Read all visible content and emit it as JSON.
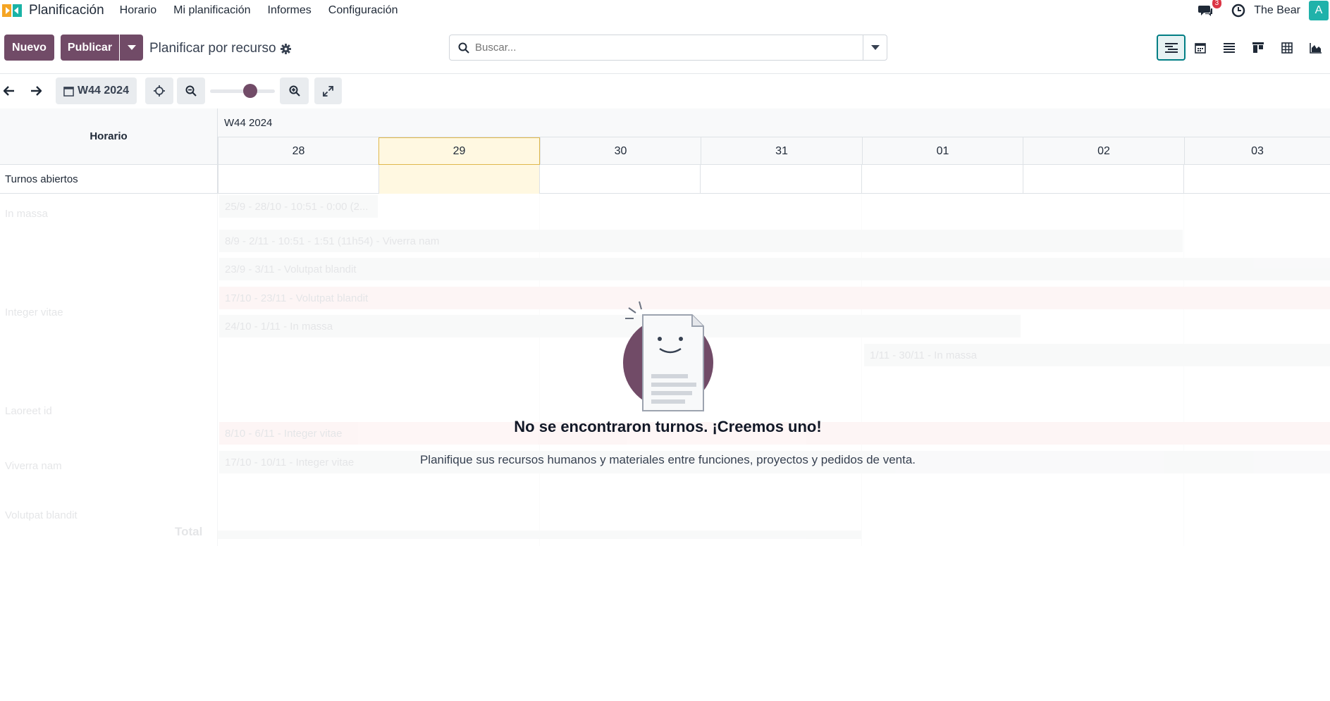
{
  "app": {
    "name": "Planificación"
  },
  "nav": [
    "Horario",
    "Mi planificación",
    "Informes",
    "Configuración"
  ],
  "user": {
    "name": "The Bear",
    "avatar_letter": "A",
    "messages_count": "3"
  },
  "toolbar": {
    "new_label": "Nuevo",
    "publish_label": "Publicar",
    "breadcrumb": "Planificar por recurso"
  },
  "search": {
    "placeholder": "Buscar..."
  },
  "views": [
    "gantt",
    "calendar",
    "list",
    "kanban",
    "pivot",
    "graph"
  ],
  "gantt": {
    "date_button": "W44 2024",
    "zoom_level": 0.65,
    "row_header": "Horario",
    "week_label": "W44 2024",
    "days": [
      "28",
      "29",
      "30",
      "31",
      "01",
      "02",
      "03"
    ],
    "today_index": 1,
    "open_shifts_label": "Turnos abiertos"
  },
  "sample": {
    "resources": [
      "In massa",
      "Integer vitae",
      "Laoreet id",
      "Viverra nam",
      "Volutpat blandit"
    ],
    "shifts": [
      "25/9 - 28/10 - 10:51 - 0:00 (2...",
      "8/9 - 2/11 - 10:51 - 1:51 (11h54) - Viverra nam",
      "23/9 - 3/11 - Volutpat blandit",
      "17/10 - 23/11 - Volutpat blandit",
      "24/10 - 1/11 - In massa",
      "1/11 - 30/11 - In massa",
      "8/10 - 6/11 - Integer vitae",
      "17/10 - 10/11 - Integer vitae"
    ],
    "total_label": "Total"
  },
  "empty": {
    "title": "No se encontraron turnos. ¡Creemos uno!",
    "text": "Planifique sus recursos humanos y materiales entre funciones, proyectos y pedidos de venta."
  },
  "colors": {
    "primary": "#714b67",
    "accent": "#017e84",
    "today": "#fff8e1"
  }
}
